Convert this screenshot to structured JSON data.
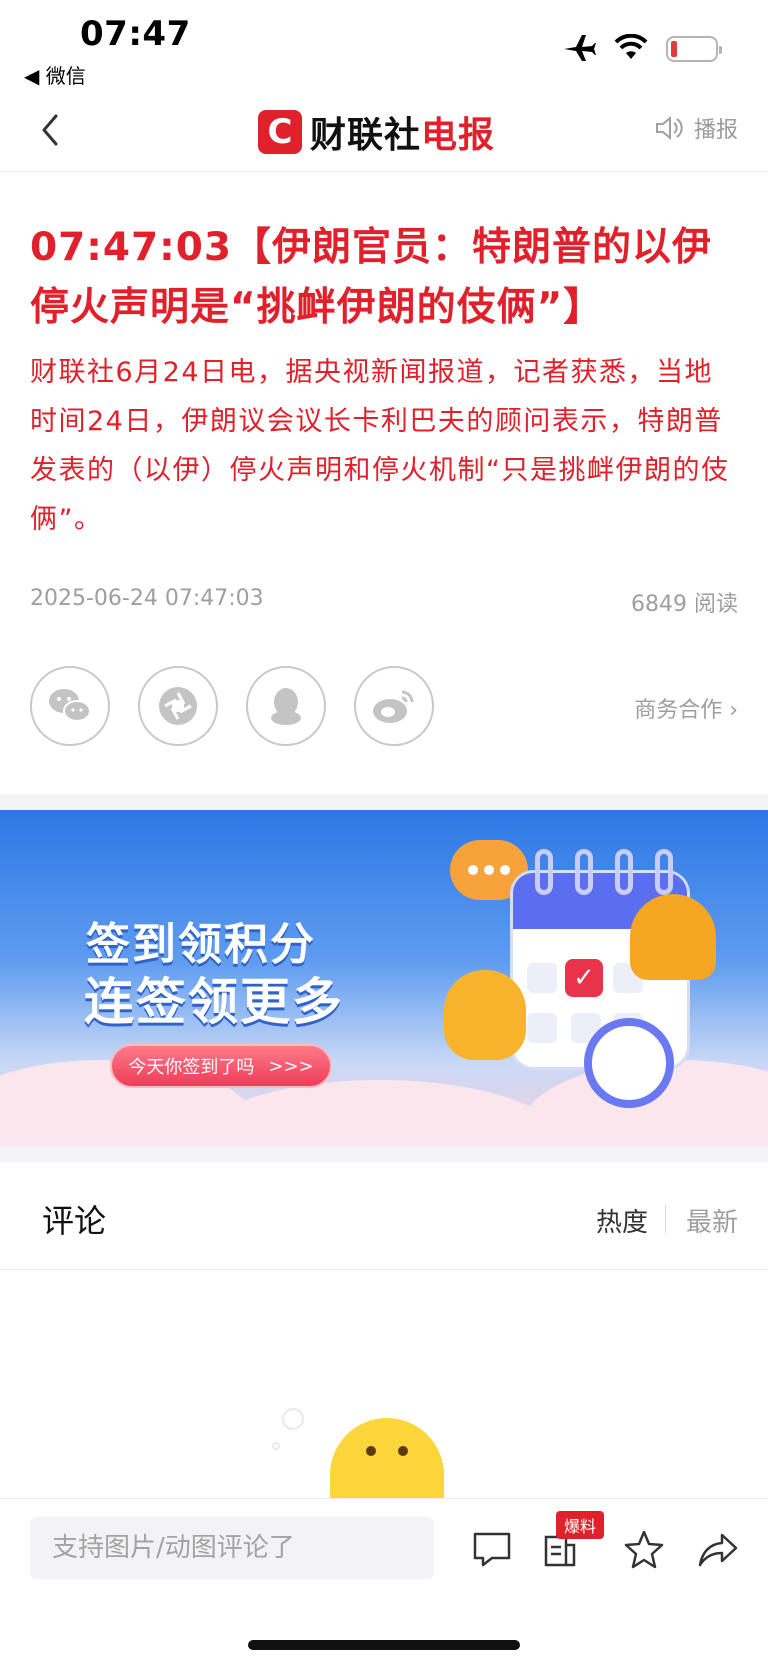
{
  "status_bar": {
    "time": "07:47",
    "back_app": "◀ 微信"
  },
  "nav": {
    "logo_mark": "C",
    "logo_text_black": "财联社",
    "logo_text_red": "电报",
    "broadcast_label": "播报"
  },
  "article": {
    "title": "07:47:03【伊朗官员：特朗普的以伊停火声明是“挑衅伊朗的伎俩”】",
    "body": "财联社6月24日电，据央视新闻报道，记者获悉，当地时间24日，伊朗议会议长卡利巴夫的顾问表示，特朗普发表的（以伊）停火声明和停火机制“只是挑衅伊朗的伎俩”。",
    "datetime": "2025-06-24 07:47:03",
    "read_count": "6849 阅读"
  },
  "share": {
    "business_link": "商务合作 ›"
  },
  "banner": {
    "line1": "签到领积分",
    "line2": "连签领更多",
    "cta": "今天你签到了吗",
    "cta_arrows": ">>>"
  },
  "comments": {
    "title": "评论",
    "sort_hot": "热度",
    "sort_new": "最新"
  },
  "bottom_bar": {
    "input_placeholder": "支持图片/动图评论了",
    "tip_badge": "爆料"
  },
  "colors": {
    "brand_red": "#e0212b",
    "muted_gray": "#9e9e9e"
  }
}
